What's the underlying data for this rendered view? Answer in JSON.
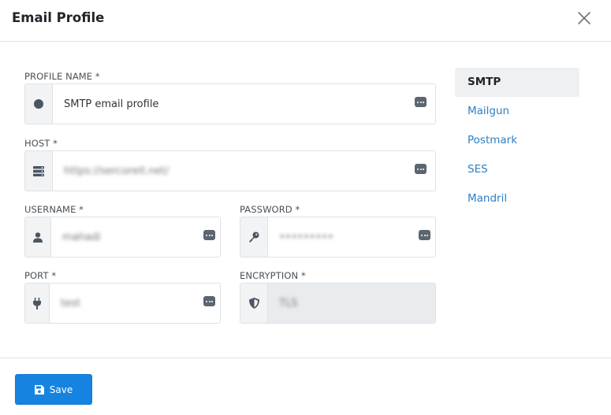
{
  "modal": {
    "title": "Email Profile"
  },
  "form": {
    "profile_name": {
      "label": "PROFILE NAME *",
      "value": "SMTP email profile"
    },
    "host": {
      "label": "HOST *",
      "value": "https://sercoreit.net/"
    },
    "username": {
      "label": "USERNAME *",
      "value": "mahadi"
    },
    "password": {
      "label": "PASSWORD *",
      "value": "123123213"
    },
    "port": {
      "label": "PORT *",
      "value": "test"
    },
    "encryption": {
      "label": "ENCRYPTION *",
      "value": "TLS"
    }
  },
  "providers": [
    {
      "label": "SMTP",
      "active": true
    },
    {
      "label": "Mailgun",
      "active": false
    },
    {
      "label": "Postmark",
      "active": false
    },
    {
      "label": "SES",
      "active": false
    },
    {
      "label": "Mandril",
      "active": false
    }
  ],
  "footer": {
    "save_label": "Save"
  },
  "icons": {
    "close": "close-icon",
    "profile": "circle-icon",
    "host": "server-icon",
    "username": "user-icon",
    "password": "key-icon",
    "port": "plug-icon",
    "encryption": "shield-icon",
    "save": "save-icon",
    "password_manager": "password-manager-icon"
  },
  "colors": {
    "primary": "#1783e0",
    "link": "#2c7fc6",
    "icon": "#5c6670"
  }
}
